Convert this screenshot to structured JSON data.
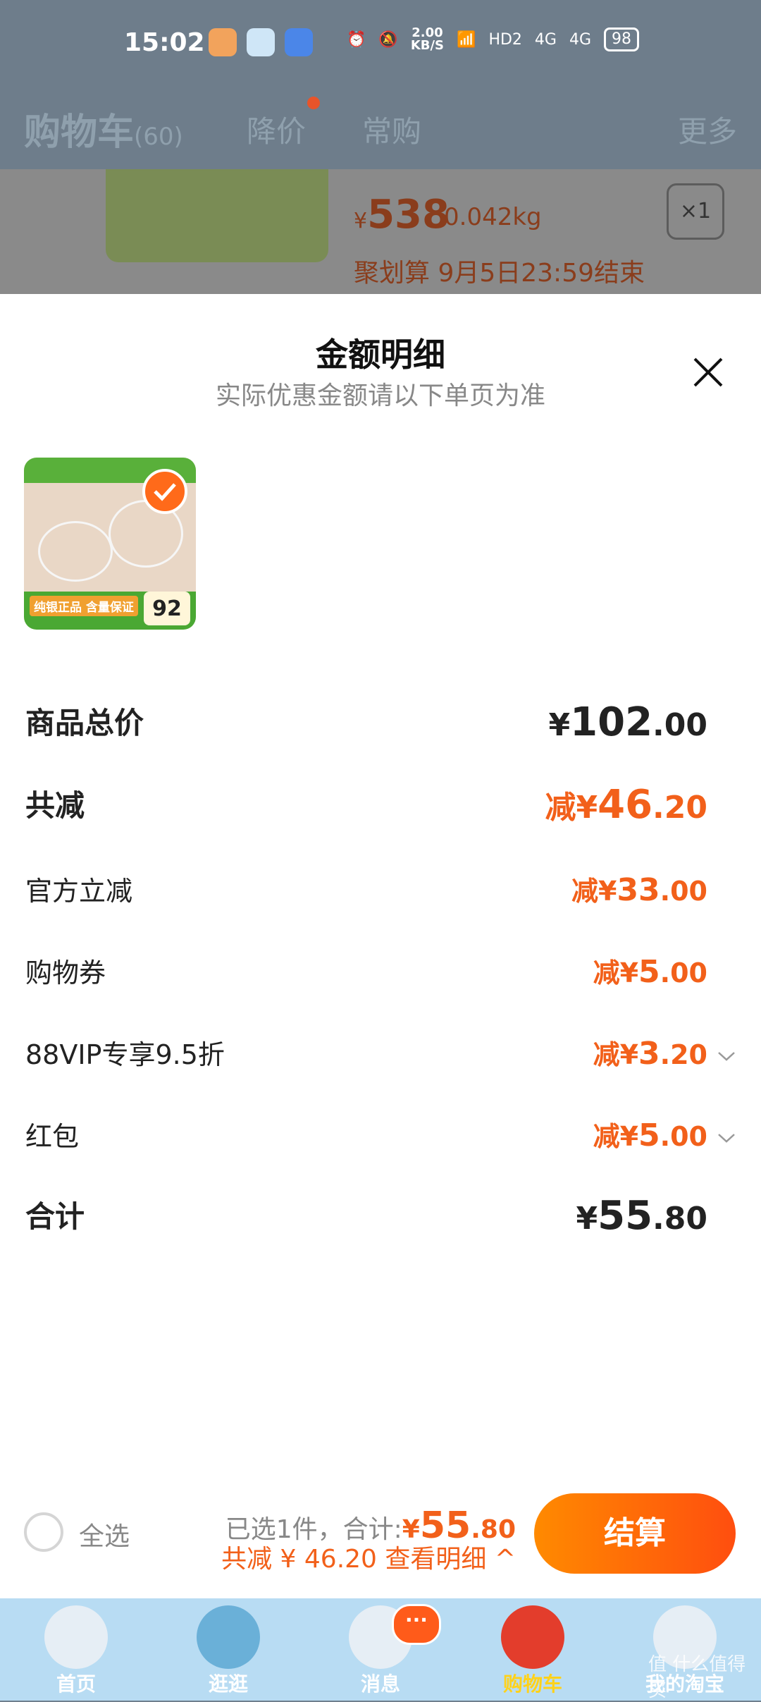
{
  "status_bar": {
    "time": "15:02",
    "net_speed_value": "2.00",
    "net_speed_unit": "KB/S",
    "signal1": "4G",
    "signal2": "4G",
    "hd": "HD2",
    "battery": "98"
  },
  "header": {
    "title": "购物车",
    "count": "(60)",
    "tab_price_drop": "降价",
    "tab_frequent": "常购",
    "more": "更多"
  },
  "bg_item": {
    "currency": "¥",
    "price": "538",
    "weight": "0.042kg",
    "quantity": "×1",
    "promo": "聚划算 9月5日23:59结束"
  },
  "sheet": {
    "title": "金额明细",
    "subtitle": "实际优惠金额请以下单页为准",
    "product": {
      "badge_price": "92",
      "label": "纯银正品 含量保证"
    },
    "rows": [
      {
        "label": "商品总价",
        "prefix": "¥",
        "int": "102",
        "dec": ".00"
      },
      {
        "label": "共减",
        "prefix": "减¥",
        "int": "46",
        "dec": ".20"
      },
      {
        "label": "官方立减",
        "prefix": "减¥",
        "int": "33",
        "dec": ".00"
      },
      {
        "label": "购物券",
        "prefix": "减¥",
        "int": "5",
        "dec": ".00"
      },
      {
        "label": "88VIP专享9.5折",
        "prefix": "减¥",
        "int": "3",
        "dec": ".20"
      },
      {
        "label": "红包",
        "prefix": "减¥",
        "int": "5",
        "dec": ".00"
      },
      {
        "label": "合计",
        "prefix": "¥",
        "int": "55",
        "dec": ".80"
      }
    ]
  },
  "bottom_bar": {
    "select_all": "全选",
    "selected_text": "已选1件，合计:",
    "total_prefix": "¥",
    "total_int": "55",
    "total_dec": ".80",
    "discount_text": "共减 ¥ 46.20 查看明细 ^",
    "checkout": "结算"
  },
  "tab_bar": {
    "tabs": [
      {
        "label": "首页",
        "color": "#e63f3f"
      },
      {
        "label": "逛逛",
        "color": "#6ab0d8"
      },
      {
        "label": "消息",
        "color": "#ffffff"
      },
      {
        "label": "购物车",
        "color": "#e33d2c"
      },
      {
        "label": "我的淘宝",
        "color": "#ffffff"
      }
    ],
    "message_badge": "···",
    "watermark": "值 什么值得买"
  }
}
